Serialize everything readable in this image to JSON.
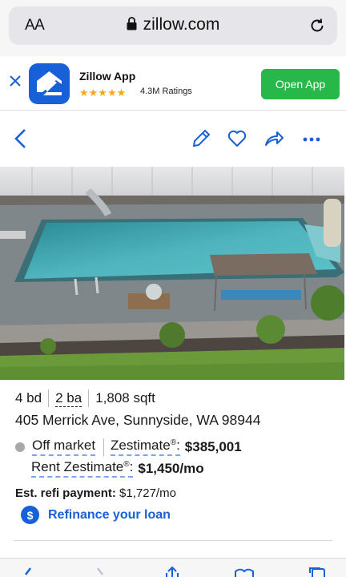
{
  "browser": {
    "text_size_label": "AA",
    "url": "zillow.com"
  },
  "app_banner": {
    "app_name": "Zillow App",
    "stars": "★★★★★",
    "ratings": "4.3M Ratings",
    "open_label": "Open App"
  },
  "listing": {
    "beds": "4 bd",
    "baths": "2 ba",
    "sqft": "1,808 sqft",
    "address": "405 Merrick Ave, Sunnyside, WA 98944",
    "status": "Off market",
    "zestimate_label": "Zestimate",
    "zestimate_value": "$385,001",
    "rent_label": "Rent Zestimate",
    "rent_value": "$1,450/mo",
    "reg_mark": "®",
    "refi_label": "Est. refi payment:",
    "refi_value": "$1,727/mo",
    "refi_link": "Refinance your loan",
    "dollar_icon": "$"
  },
  "colors": {
    "brand_blue": "#1760d8",
    "open_green": "#28b84a",
    "star_gold": "#f5a623",
    "status_gray": "#a8a8a8"
  },
  "icons": [
    "lock-icon",
    "reload-icon",
    "close-icon",
    "zillow-logo-icon",
    "back-icon",
    "edit-icon",
    "heart-icon",
    "share-icon",
    "more-icon",
    "dollar-icon",
    "browser-back-icon",
    "browser-forward-icon",
    "browser-share-icon",
    "bookmarks-icon",
    "tabs-icon"
  ]
}
